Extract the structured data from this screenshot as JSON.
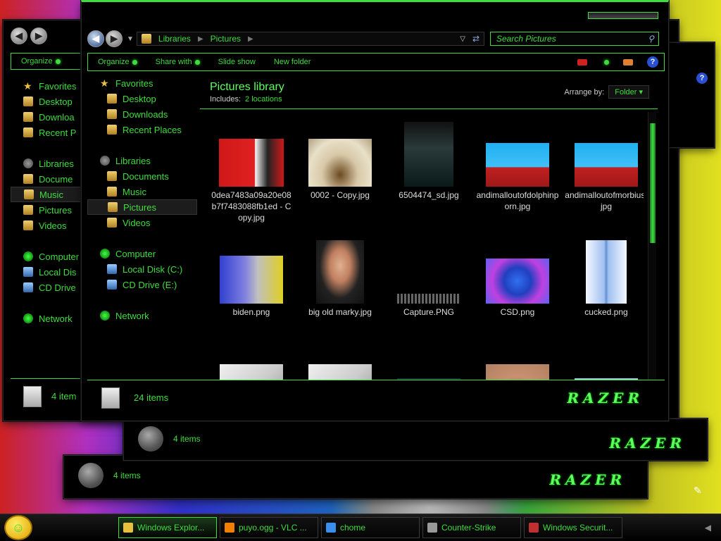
{
  "main": {
    "address": [
      "Libraries",
      "Pictures"
    ],
    "search_placeholder": "Search Pictures",
    "toolbar": {
      "organize": "Organize",
      "share": "Share with",
      "slideshow": "Slide show",
      "newfolder": "New folder"
    },
    "nav": {
      "favorites": "Favorites",
      "desktop": "Desktop",
      "downloads": "Downloads",
      "recent": "Recent Places",
      "libraries": "Libraries",
      "documents": "Documents",
      "music": "Music",
      "pictures": "Pictures",
      "videos": "Videos",
      "computer": "Computer",
      "localdisk": "Local Disk (C:)",
      "cddrive": "CD Drive (E:)",
      "network": "Network"
    },
    "library": {
      "title": "Pictures library",
      "includes": "Includes:",
      "locations": "2 locations",
      "arrange_label": "Arrange by:",
      "arrange_value": "Folder"
    },
    "files": [
      {
        "name": "0dea7483a09a20e08b7f7483088fb1ed - Copy.jpg",
        "thumb": "red-cartoon",
        "w": 92,
        "h": 68
      },
      {
        "name": "0002 - Copy.jpg",
        "thumb": "urinal",
        "w": 90,
        "h": 68
      },
      {
        "name": "6504474_sd.jpg",
        "thumb": "poster",
        "w": 70,
        "h": 92
      },
      {
        "name": "andimalloutofdolphinporn.jpg",
        "thumb": "cartoon-blue",
        "w": 90,
        "h": 62
      },
      {
        "name": "andimalloutofmorbius.jpg",
        "thumb": "cartoon-blue",
        "w": 90,
        "h": 62
      },
      {
        "name": "biden.png",
        "thumb": "photo-blue",
        "w": 90,
        "h": 68
      },
      {
        "name": "big old marky.jpg",
        "thumb": "portrait",
        "w": 68,
        "h": 90
      },
      {
        "name": "Capture.PNG",
        "thumb": "text",
        "w": 90,
        "h": 14
      },
      {
        "name": "CSD.png",
        "thumb": "csd",
        "w": 90,
        "h": 64
      },
      {
        "name": "cucked.png",
        "thumb": "figure",
        "w": 58,
        "h": 90
      },
      {
        "name": "",
        "thumb": "doc",
        "w": 90,
        "h": 80
      },
      {
        "name": "",
        "thumb": "doc",
        "w": 90,
        "h": 80
      },
      {
        "name": "",
        "thumb": "dark",
        "w": 90,
        "h": 60
      },
      {
        "name": "",
        "thumb": "skin",
        "w": 90,
        "h": 80
      },
      {
        "name": "",
        "thumb": "pyramid",
        "w": 90,
        "h": 60
      }
    ],
    "status": "24 items"
  },
  "back_a": {
    "toolbar": "Organize",
    "nav": [
      "Favorites",
      "Desktop",
      "Downloa",
      "Recent P",
      "",
      "Libraries",
      "Docume",
      "Music",
      "Pictures",
      "Videos",
      "",
      "Computer",
      "Local Dis",
      "CD Drive",
      "",
      "Network"
    ],
    "status": "4 item"
  },
  "back_b": {
    "status": "4 items"
  },
  "back_c": {
    "status": "4 items"
  },
  "taskbar": {
    "tasks": [
      {
        "label": "Windows Explor...",
        "color": "#e8c040"
      },
      {
        "label": "puyo.ogg - VLC ...",
        "color": "#f08000"
      },
      {
        "label": "chome",
        "color": "#3a8ef0"
      },
      {
        "label": "Counter-Strike",
        "color": "#999999"
      },
      {
        "label": "Windows Securit...",
        "color": "#c03030"
      }
    ]
  },
  "colors": {
    "accent": "#3fdc3f",
    "background": "#000000"
  }
}
